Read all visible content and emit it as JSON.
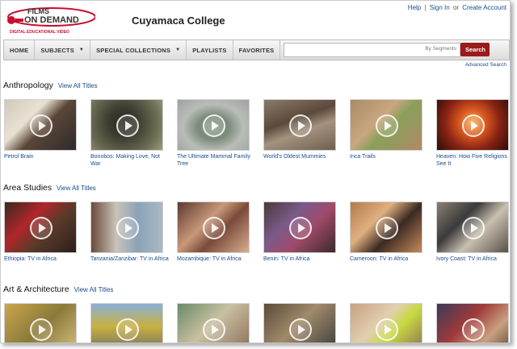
{
  "header": {
    "logo_line1": "FILMS",
    "logo_line2": "ON DEMAND",
    "logo_tagline": "DIGITAL EDUCATIONAL VIDEO",
    "college": "Cuyamaca College",
    "help": "Help",
    "signin": "Sign In",
    "or": "or",
    "create_account": "Create Account"
  },
  "nav": {
    "home": "HOME",
    "subjects": "SUBJECTS",
    "special": "SPECIAL COLLECTIONS",
    "playlists": "PLAYLISTS",
    "favorites": "FAVORITES",
    "search_value": "",
    "search_select": "By Segments",
    "search_button": "Search",
    "advanced": "Advanced Search"
  },
  "sections": [
    {
      "title": "Anthropology",
      "view_all": "View All Titles",
      "items": [
        {
          "caption": "Petrol Brain"
        },
        {
          "caption": "Bonobos: Making Love, Not War"
        },
        {
          "caption": "The Ultimate Mammal Family Tree"
        },
        {
          "caption": "World's Oldest Mummies"
        },
        {
          "caption": "Inca Trails"
        },
        {
          "caption": "Heaven: How Five Religions See It"
        }
      ]
    },
    {
      "title": "Area Studies",
      "view_all": "View All Titles",
      "items": [
        {
          "caption": "Ethiopia: TV in Africa"
        },
        {
          "caption": "Tanzania/Zanzibar: TV in Africa"
        },
        {
          "caption": "Mozambique: TV in Africa"
        },
        {
          "caption": "Benin: TV in Africa"
        },
        {
          "caption": "Cameroon: TV in Africa"
        },
        {
          "caption": "Ivory Coast: TV in Africa"
        }
      ]
    },
    {
      "title": "Art & Architecture",
      "view_all": "View All Titles",
      "items": [
        {
          "caption": ""
        },
        {
          "caption": ""
        },
        {
          "caption": ""
        },
        {
          "caption": ""
        },
        {
          "caption": ""
        },
        {
          "caption": ""
        }
      ]
    }
  ],
  "colors": {
    "brand_red": "#c8102e",
    "search_button": "#9b1b1b",
    "link_blue": "#1b4b8a"
  }
}
